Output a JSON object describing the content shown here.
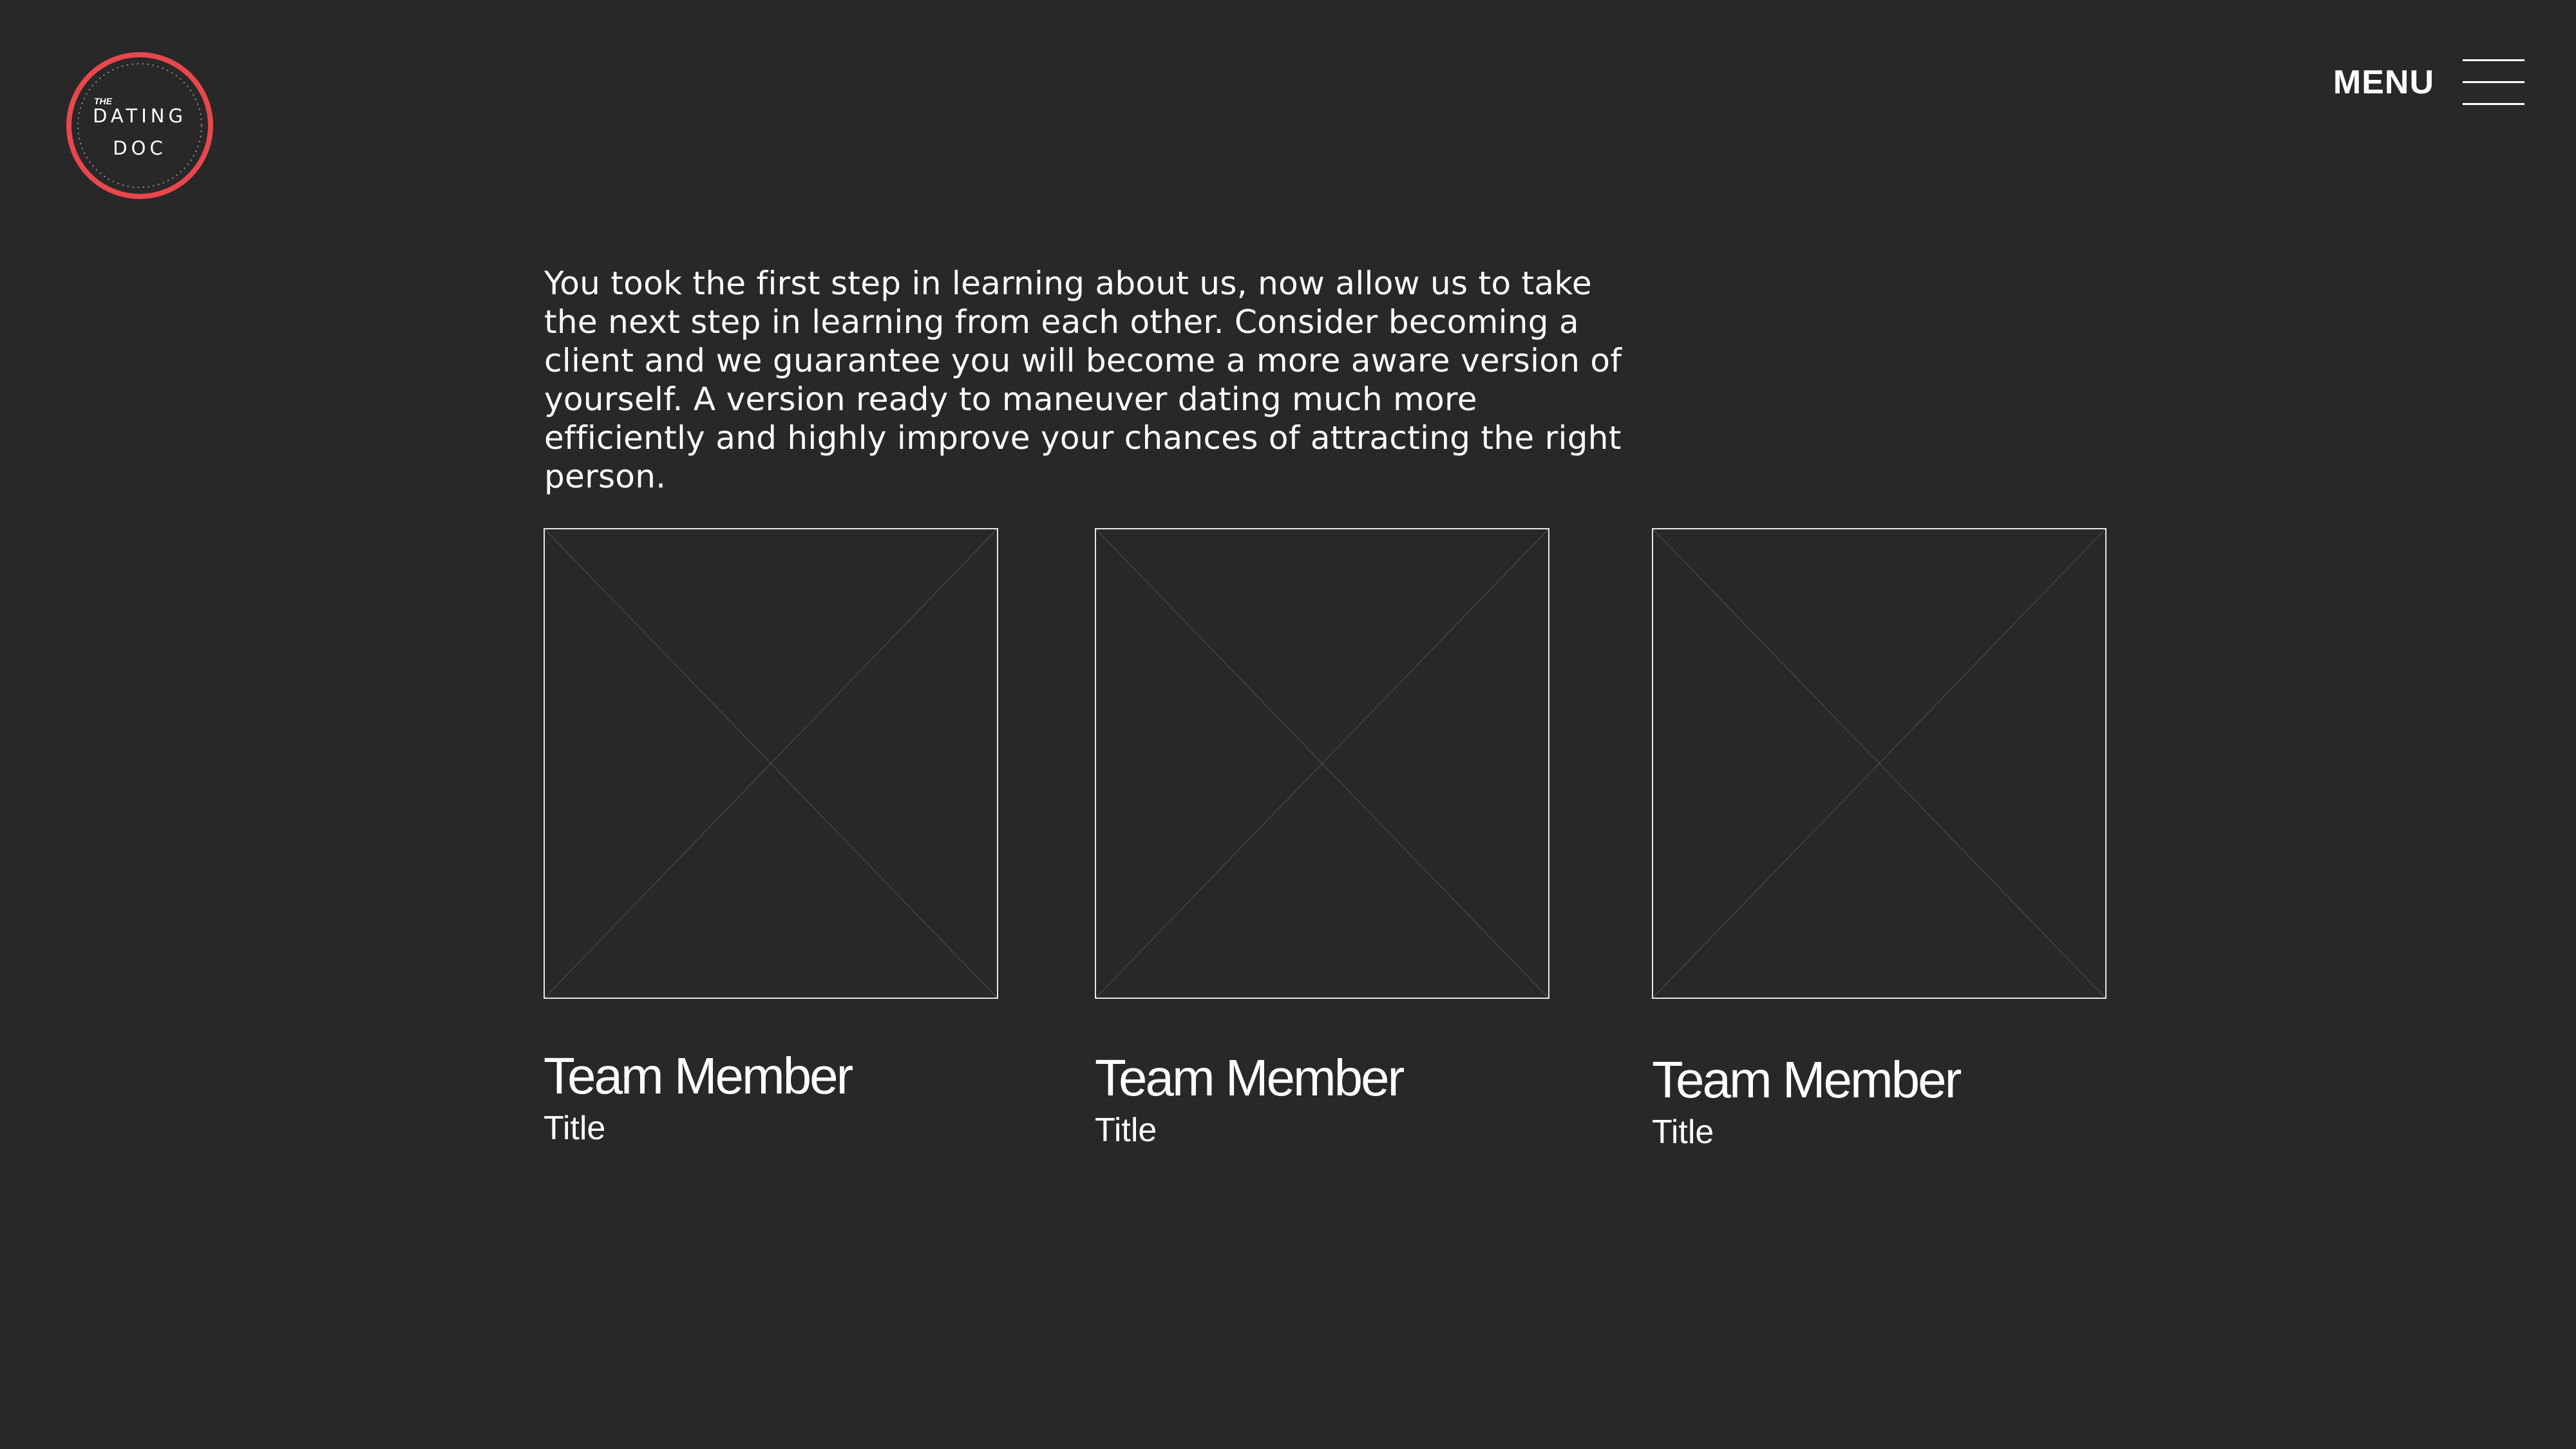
{
  "logo": {
    "small_text": "THE",
    "line1": "DATING",
    "line2": "DOC",
    "ring_color": "#e8474b"
  },
  "nav": {
    "menu_label": "MENU",
    "menu_icon": "hamburger-icon"
  },
  "intro": {
    "text": "You took the first step in learning about us, now allow us to take the next step in learning from each other. Consider becoming a client and we guarantee you will become a more aware version of yourself. A version ready to maneuver dating much more efficiently and highly improve your chances of attracting the right person."
  },
  "team": {
    "members": [
      {
        "name": "Team Member",
        "title": "Title",
        "photo": "image-placeholder-icon"
      },
      {
        "name": "Team Member",
        "title": "Title",
        "photo": "image-placeholder-icon"
      },
      {
        "name": "Team Member",
        "title": "Title",
        "photo": "image-placeholder-icon"
      }
    ]
  },
  "colors": {
    "background": "#282828",
    "text": "#ffffff",
    "accent": "#e8474b"
  }
}
